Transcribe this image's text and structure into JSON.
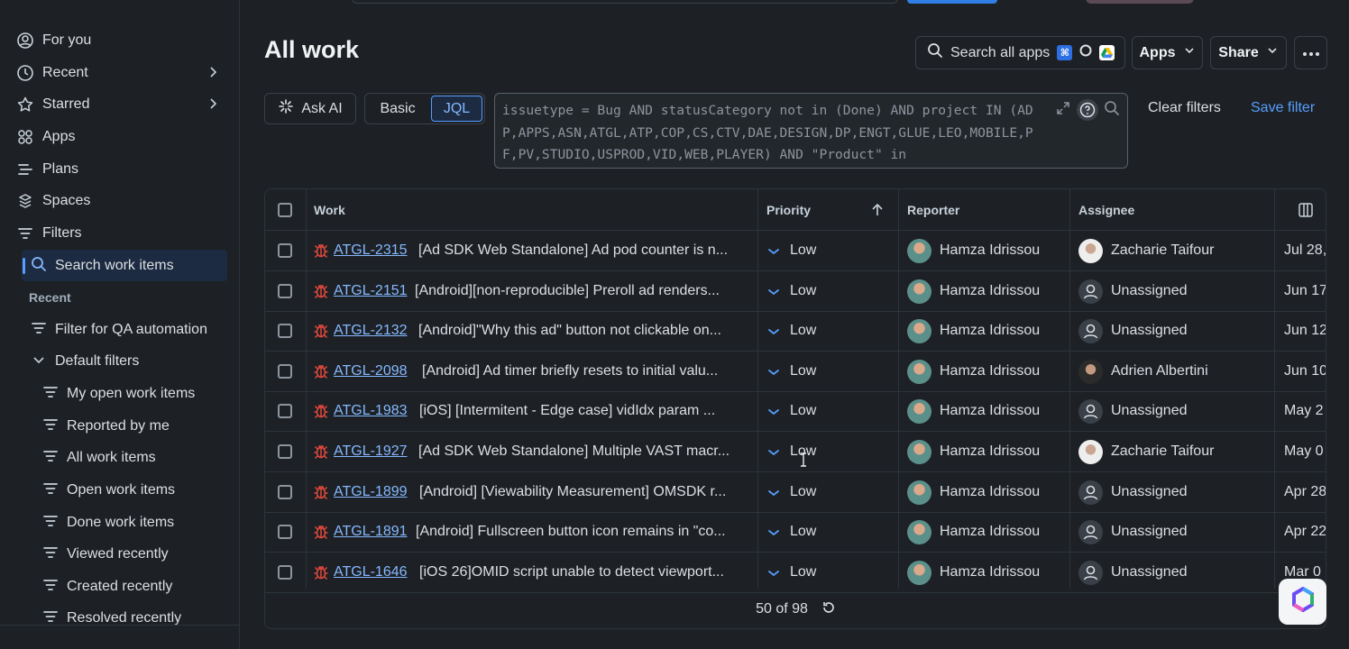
{
  "sidebar": {
    "items": [
      {
        "label": "For you",
        "icon": "user-circle-icon"
      },
      {
        "label": "Recent",
        "icon": "clock-icon"
      },
      {
        "label": "Starred",
        "icon": "star-icon"
      },
      {
        "label": "Apps",
        "icon": "apps-grid-icon"
      },
      {
        "label": "Plans",
        "icon": "plans-icon"
      },
      {
        "label": "Spaces",
        "icon": "spaces-icon"
      },
      {
        "label": "Filters",
        "icon": "filter-icon"
      }
    ],
    "active_item": "Search work items",
    "recent_label": "Recent",
    "recent_filter": "Filter for QA automation",
    "default_filters_label": "Default filters",
    "default_filters": [
      "My open work items",
      "Reported by me",
      "All work items",
      "Open work items",
      "Done work items",
      "Viewed recently",
      "Created recently",
      "Resolved recently"
    ]
  },
  "header": {
    "title": "All work",
    "search_label": "Search all apps",
    "apps_label": "Apps",
    "share_label": "Share"
  },
  "filter_bar": {
    "ask_ai": "Ask AI",
    "basic": "Basic",
    "jql": "JQL",
    "jql_query": "issuetype = Bug AND statusCategory not in (Done) AND project IN (ADP,APPS,ASN,ATGL,ATP,COP,CS,CTV,DAE,DESIGN,DP,ENGT,GLUE,LEO,MOBILE,PF,PV,STUDIO,USPROD,VID,WEB,PLAYER) AND \"Product\" in",
    "clear_filters": "Clear filters",
    "save_filter": "Save filter"
  },
  "table": {
    "columns": [
      "Work",
      "Priority",
      "Reporter",
      "Assignee"
    ],
    "rows": [
      {
        "key": "ATGL-2315",
        "summary": "[Ad SDK Web Standalone] Ad pod counter is n...",
        "priority": "Low",
        "reporter": "Hamza Idrissou",
        "assignee": "Zacharie Taifour",
        "date": "Jul 28,"
      },
      {
        "key": "ATGL-2151",
        "summary": "[Android][non-reproducible] Preroll ad renders...",
        "priority": "Low",
        "reporter": "Hamza Idrissou",
        "assignee": "Unassigned",
        "date": "Jun 17,"
      },
      {
        "key": "ATGL-2132",
        "summary": "[Android]\"Why this ad\" button not clickable on...",
        "priority": "Low",
        "reporter": "Hamza Idrissou",
        "assignee": "Unassigned",
        "date": "Jun 12"
      },
      {
        "key": "ATGL-2098",
        "summary": "[Android] Ad timer briefly resets to initial valu...",
        "priority": "Low",
        "reporter": "Hamza Idrissou",
        "assignee": "Adrien Albertini",
        "date": "Jun 10"
      },
      {
        "key": "ATGL-1983",
        "summary": "[iOS] [Intermitent - Edge case] vidIdx param ...",
        "priority": "Low",
        "reporter": "Hamza Idrissou",
        "assignee": "Unassigned",
        "date": "May 2"
      },
      {
        "key": "ATGL-1927",
        "summary": "[Ad SDK Web Standalone] Multiple VAST macr...",
        "priority": "Low",
        "reporter": "Hamza Idrissou",
        "assignee": "Zacharie Taifour",
        "date": "May 0"
      },
      {
        "key": "ATGL-1899",
        "summary": "[Android] [Viewability Measurement] OMSDK r...",
        "priority": "Low",
        "reporter": "Hamza Idrissou",
        "assignee": "Unassigned",
        "date": "Apr 28"
      },
      {
        "key": "ATGL-1891",
        "summary": "[Android] Fullscreen button icon remains in \"co...",
        "priority": "Low",
        "reporter": "Hamza Idrissou",
        "assignee": "Unassigned",
        "date": "Apr 22"
      },
      {
        "key": "ATGL-1646",
        "summary": "[iOS 26]OMID script unable to detect viewport...",
        "priority": "Low",
        "reporter": "Hamza Idrissou",
        "assignee": "Unassigned",
        "date": "Mar 0"
      }
    ],
    "pagination": "50 of 98"
  },
  "colors": {
    "background": "#1d2125",
    "link": "#85b8ff",
    "accent": "#579dff",
    "bug": "#e2483d"
  }
}
